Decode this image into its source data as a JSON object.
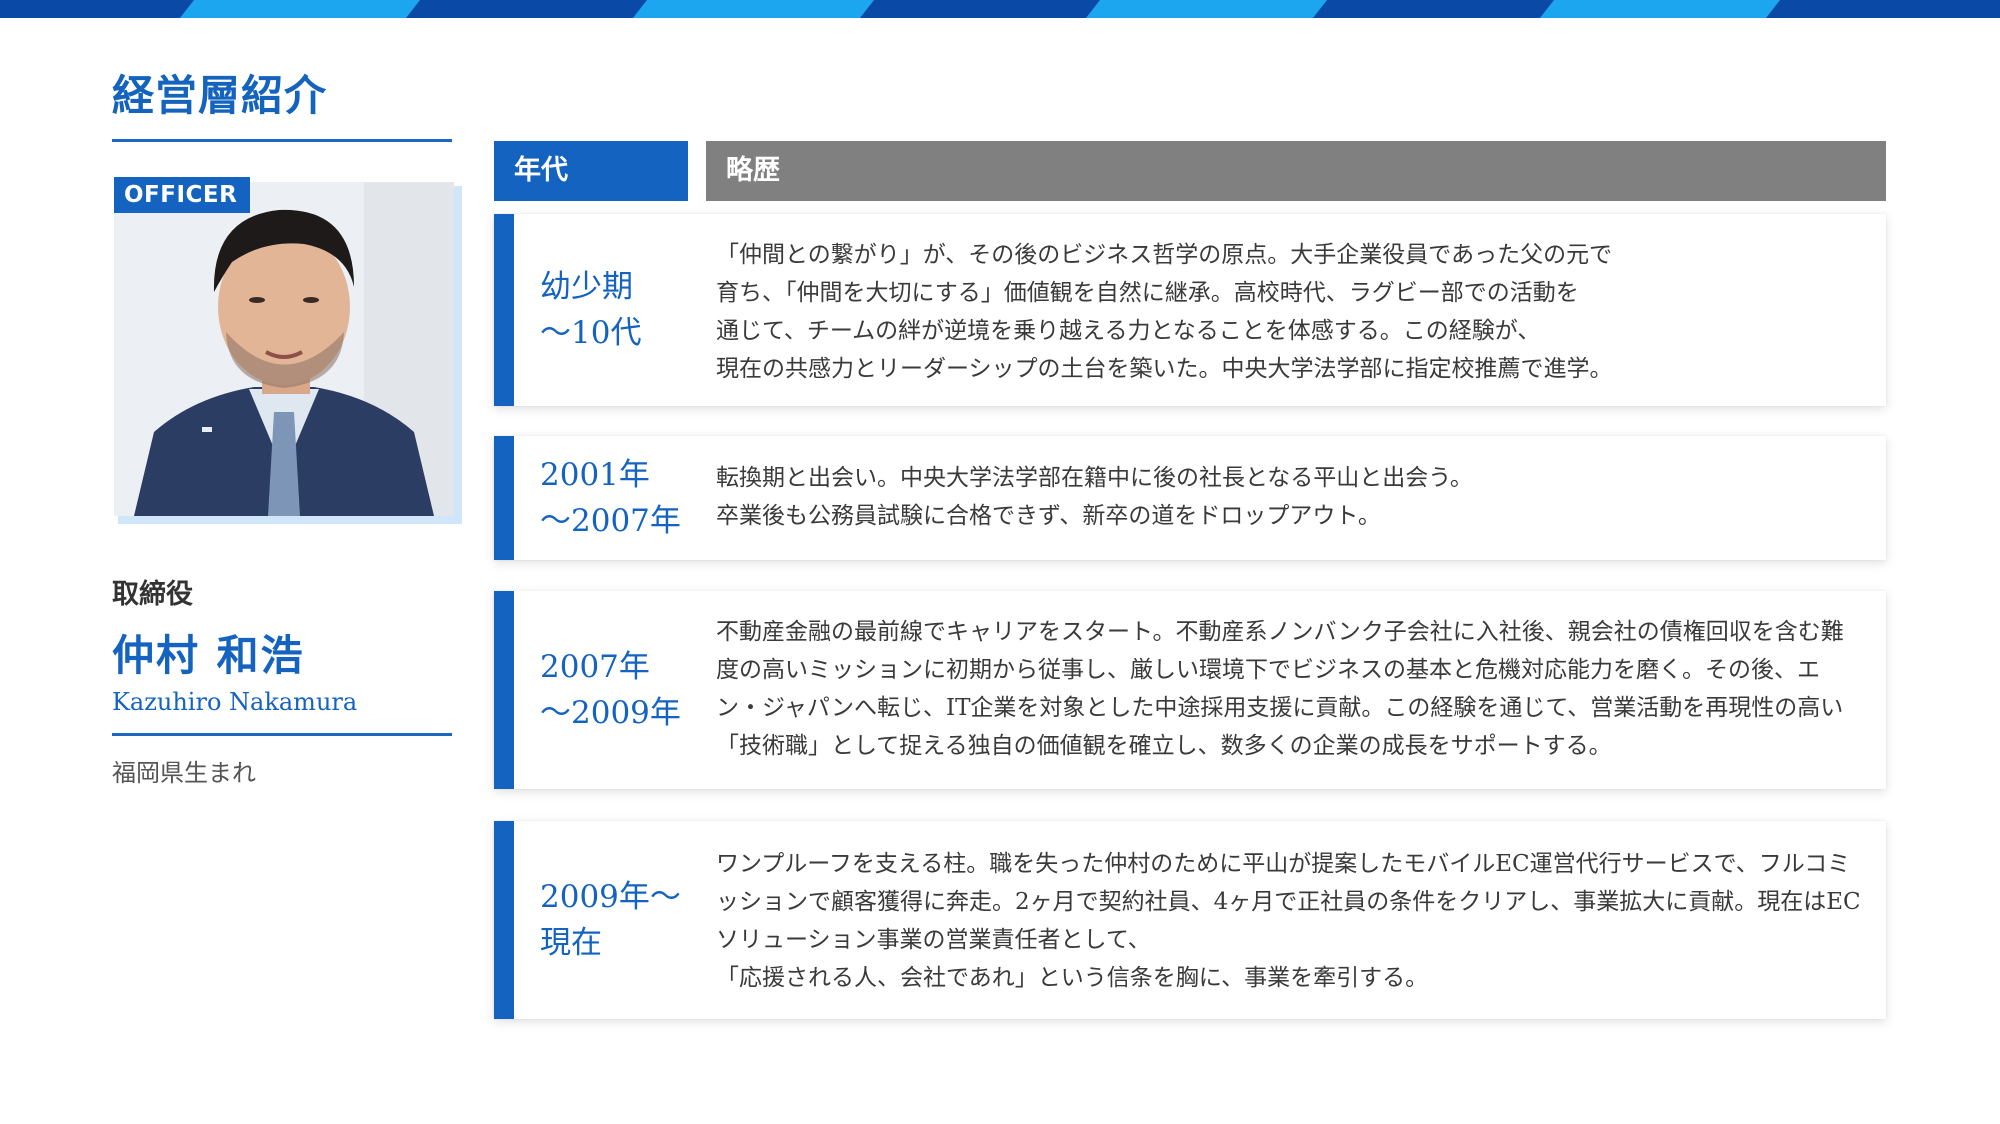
{
  "header": {
    "title": "経営層紹介"
  },
  "profile": {
    "badge": "OFFICER",
    "role": "取締役",
    "name_jp": "仲村 和浩",
    "name_en": "Kazuhiro Nakamura",
    "birthplace": "福岡県生まれ"
  },
  "table": {
    "headers": {
      "era": "年代",
      "history": "略歴"
    },
    "rows": [
      {
        "era": "幼少期\n～10代",
        "lines": [
          "「仲間との繋がり」が、その後のビジネス哲学の原点。大手企業役員であった父の元で",
          "育ち、「仲間を大切にする」価値観を自然に継承。高校時代、ラグビー部での活動を",
          "通じて、チームの絆が逆境を乗り越える力となることを体感する。この経験が、",
          "現在の共感力とリーダーシップの土台を築いた。中央大学法学部に指定校推薦で進学。"
        ]
      },
      {
        "era": "2001年\n～2007年",
        "lines": [
          "転換期と出会い。中央大学法学部在籍中に後の社長となる平山と出会う。",
          "卒業後も公務員試験に合格できず、新卒の道をドロップアウト。"
        ]
      },
      {
        "era": "2007年\n～2009年",
        "lines": [
          "不動産金融の最前線でキャリアをスタート。不動産系ノンバンク子会社に入社後、親会社の債権回収を含む難度の高いミッションに初期から従事し、厳しい環境下でビジネスの基本と危機対応能力を磨く。その後、エン・ジャパンへ転じ、IT企業を対象とした中途採用支援に貢献。この経験を通じて、営業活動を再現性の高い「技術職」として捉える独自の価値観を確立し、数多くの企業の成長をサポートする。"
        ]
      },
      {
        "era": "2009年～\n現在",
        "lines": [
          "ワンプルーフを支える柱。職を失った仲村のために平山が提案したモバイルEC運営代行サービスで、フルコミッションで顧客獲得に奔走。2ヶ月で契約社員、4ヶ月で正社員の条件をクリアし、事業拡大に貢献。現在はECソリューション事業の営業責任者として、",
          "「応援される人、会社であれ」という信条を胸に、事業を牽引する。"
        ]
      }
    ]
  }
}
